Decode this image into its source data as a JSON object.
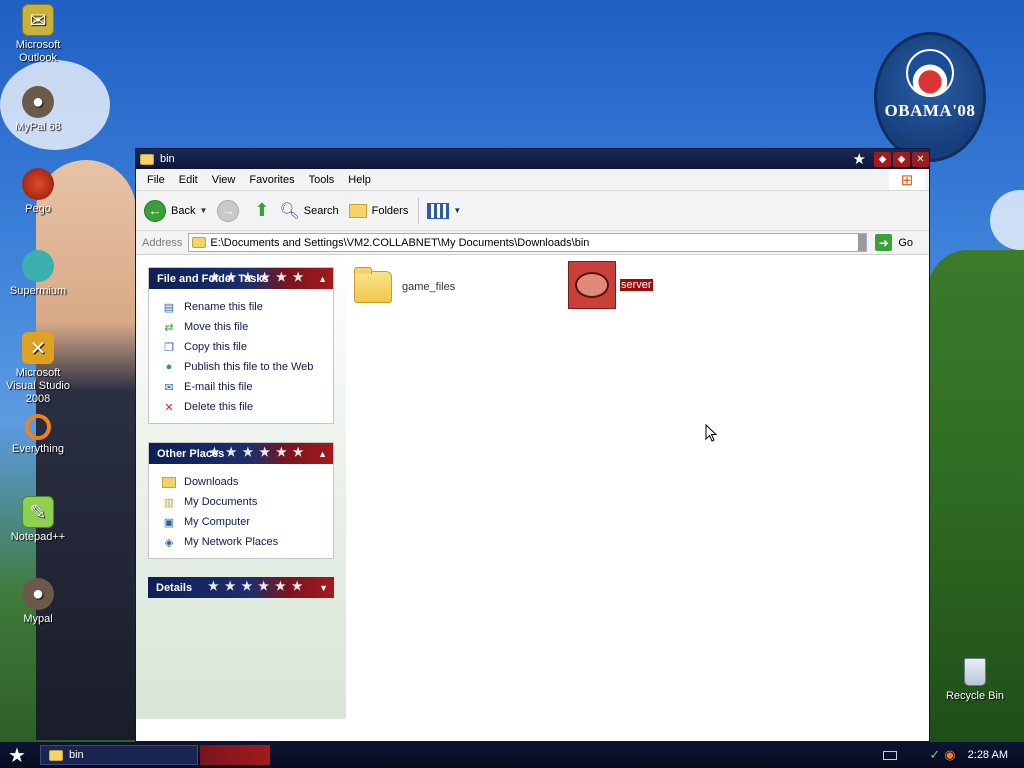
{
  "desktop": {
    "icons": [
      {
        "label": "Microsoft Outlook",
        "icon": "outlook-icon"
      },
      {
        "label": "MyPal 68",
        "icon": "mypal-icon"
      },
      {
        "label": "Pego",
        "icon": "pego-icon"
      },
      {
        "label": "Supermium",
        "icon": "supermium-icon"
      },
      {
        "label": "Microsoft Visual Studio 2008",
        "icon": "visual-studio-icon"
      },
      {
        "label": "Everything",
        "icon": "everything-icon"
      },
      {
        "label": "Notepad++",
        "icon": "notepadpp-icon"
      },
      {
        "label": "Mypal",
        "icon": "mypal-icon"
      }
    ],
    "recycle_bin": "Recycle Bin",
    "wallpaper_badge": "OBAMA'08"
  },
  "window": {
    "title": "bin",
    "menu": [
      "File",
      "Edit",
      "View",
      "Favorites",
      "Tools",
      "Help"
    ],
    "toolbar": {
      "back": "Back",
      "search": "Search",
      "folders": "Folders"
    },
    "address": {
      "label": "Address",
      "path": "E:\\Documents and Settings\\VM2.COLLABNET\\My Documents\\Downloads\\bin",
      "go": "Go"
    },
    "panels": {
      "file_tasks": {
        "title": "File and Folder Tasks",
        "items": [
          {
            "label": "Rename this file",
            "icon": "rename-icon"
          },
          {
            "label": "Move this file",
            "icon": "move-icon"
          },
          {
            "label": "Copy this file",
            "icon": "copy-icon"
          },
          {
            "label": "Publish this file to the Web",
            "icon": "publish-icon"
          },
          {
            "label": "E-mail this file",
            "icon": "email-icon"
          },
          {
            "label": "Delete this file",
            "icon": "delete-icon"
          }
        ]
      },
      "other_places": {
        "title": "Other Places",
        "items": [
          {
            "label": "Downloads",
            "icon": "folder-icon"
          },
          {
            "label": "My Documents",
            "icon": "my-documents-icon"
          },
          {
            "label": "My Computer",
            "icon": "my-computer-icon"
          },
          {
            "label": "My Network Places",
            "icon": "network-icon"
          }
        ]
      },
      "details": {
        "title": "Details"
      }
    },
    "files": [
      {
        "name": "game_files",
        "type": "folder",
        "selected": false
      },
      {
        "name": "server",
        "type": "file",
        "selected": true
      }
    ]
  },
  "taskbar": {
    "task": "bin",
    "clock": "2:28 AM"
  },
  "colors": {
    "accent_navy": "#0e1f55",
    "accent_red": "#a31a1a",
    "selection": "#9b0d0d"
  }
}
